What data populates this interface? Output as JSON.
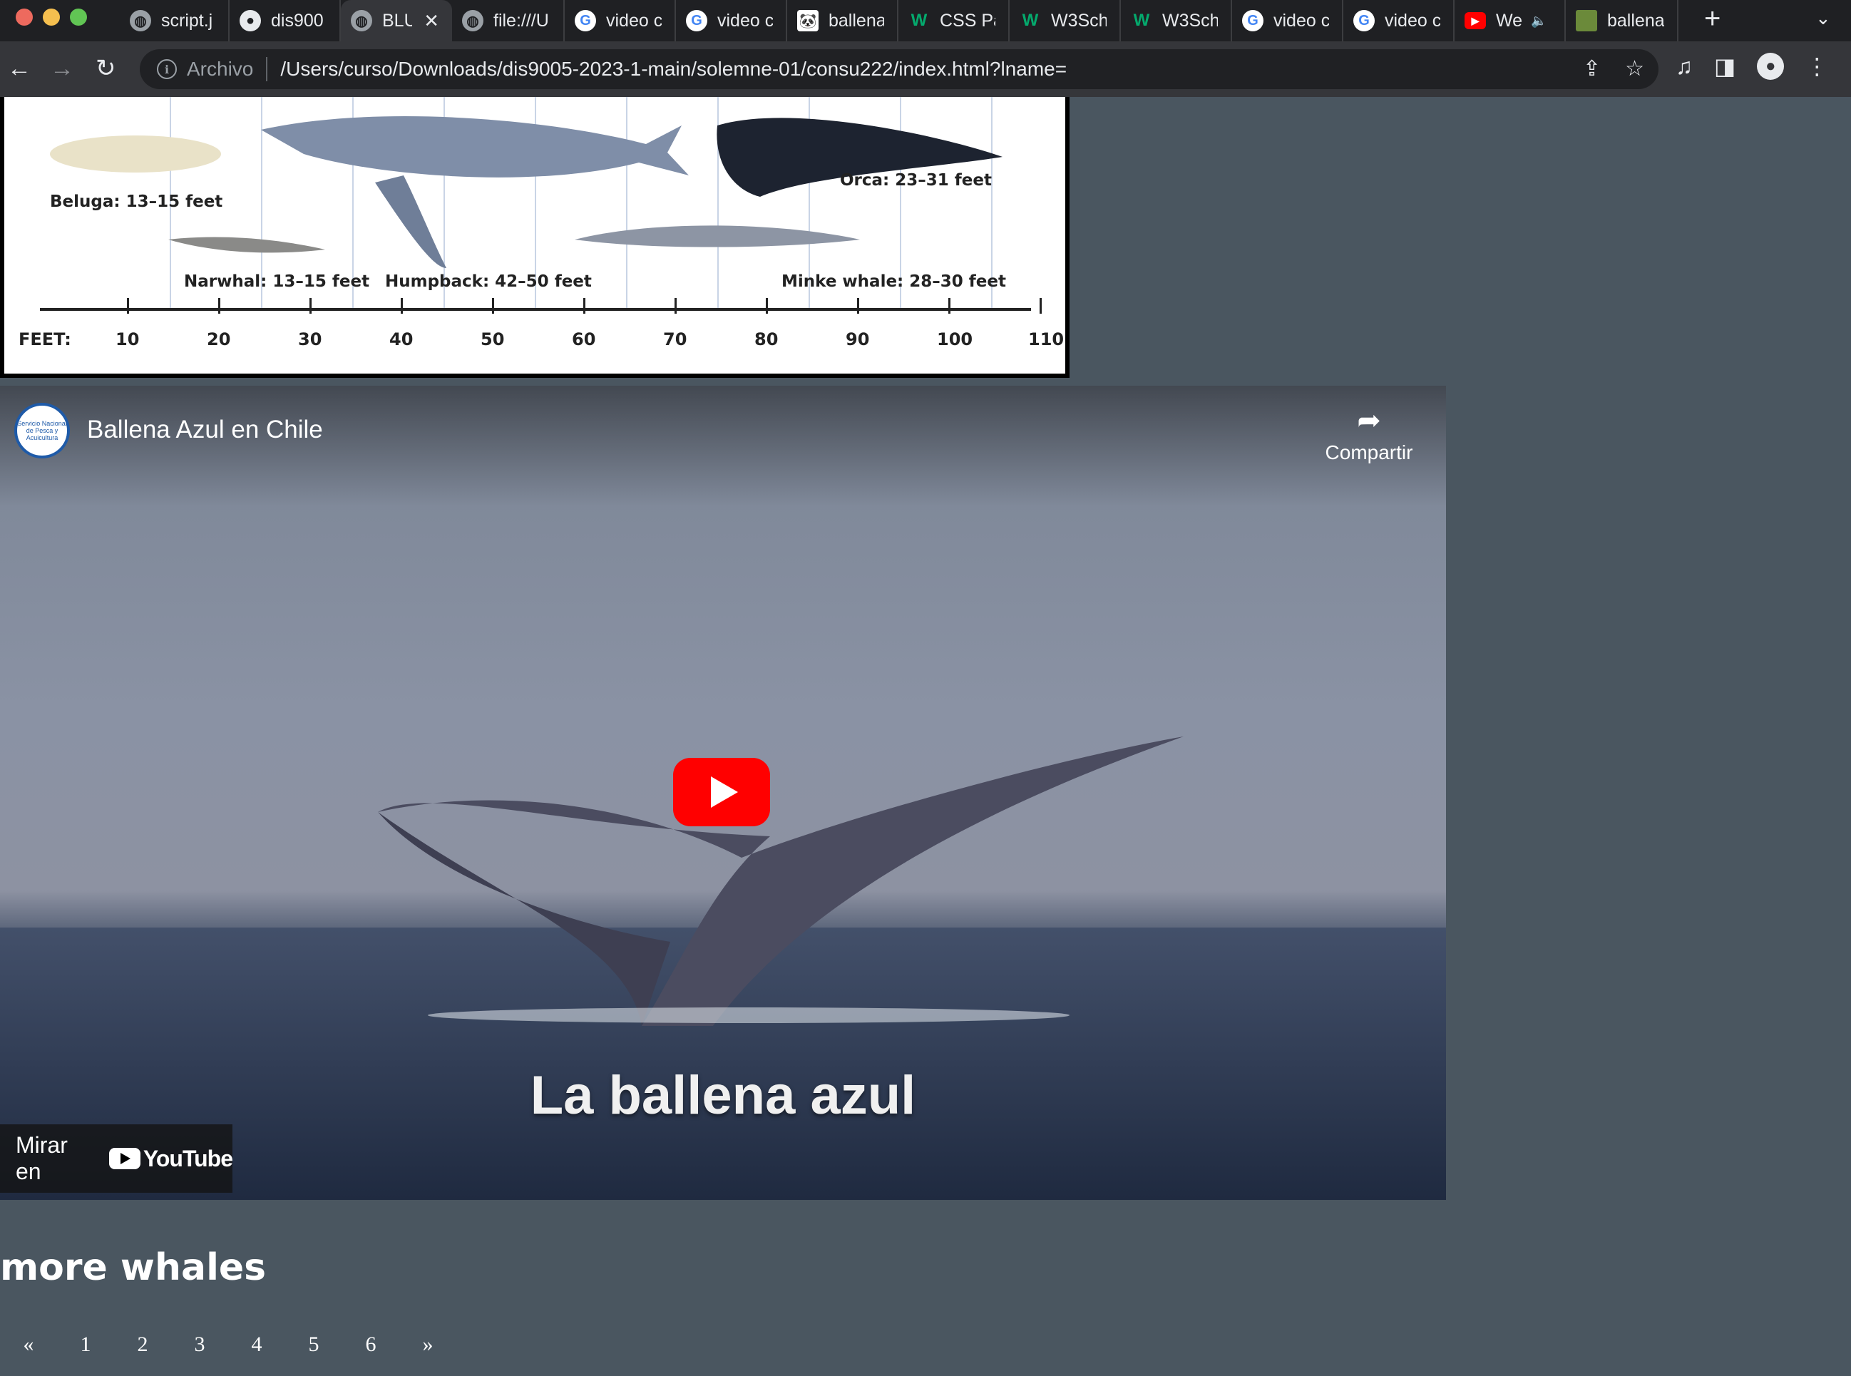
{
  "browser": {
    "tabs": [
      {
        "favicon": "globe-icon",
        "label": "script.j"
      },
      {
        "favicon": "github-icon",
        "label": "dis900"
      },
      {
        "favicon": "globe-icon",
        "label": "BLU",
        "active": true
      },
      {
        "favicon": "globe-icon",
        "label": "file:///U"
      },
      {
        "favicon": "google-icon",
        "label": "video c"
      },
      {
        "favicon": "google-icon",
        "label": "video c"
      },
      {
        "favicon": "wwf-panda-icon",
        "label": "ballena"
      },
      {
        "favicon": "w3schools-icon",
        "label": "CSS Pa"
      },
      {
        "favicon": "w3schools-icon",
        "label": "W3Sch"
      },
      {
        "favicon": "w3schools-icon",
        "label": "W3Sch"
      },
      {
        "favicon": "google-icon",
        "label": "video c"
      },
      {
        "favicon": "google-icon",
        "label": "video c"
      },
      {
        "favicon": "youtube-icon",
        "label": "We",
        "audio": true
      },
      {
        "favicon": "image-icon",
        "label": "ballena"
      }
    ],
    "new_tab_symbol": "+",
    "tab_menu_symbol": "⌄",
    "address": {
      "security_label": "Archivo",
      "url": "/Users/curso/Downloads/dis9005-2023-1-main/solemne-01/consu222/index.html?lname="
    }
  },
  "size_chart": {
    "whales": [
      {
        "label": "Beluga: 13–15 feet"
      },
      {
        "label": "Narwhal: 13–15 feet"
      },
      {
        "label": "Humpback: 42–50 feet"
      },
      {
        "label": "Orca: 23–31 feet"
      },
      {
        "label": "Minke whale: 28–30 feet"
      }
    ],
    "axis_label": "FEET:",
    "ticks": [
      "10",
      "20",
      "30",
      "40",
      "50",
      "60",
      "70",
      "80",
      "90",
      "100",
      "110"
    ]
  },
  "video": {
    "channel_logo_text": "Servicio Nacional de Pesca y Acuicultura",
    "title": "Ballena Azul en Chile",
    "share_label": "Compartir",
    "caption": "La ballena azul",
    "watch_on_label": "Mirar en",
    "youtube_word": "YouTube"
  },
  "section": {
    "title": "more whales"
  },
  "pagination": {
    "prev": "«",
    "pages": [
      "1",
      "2",
      "3",
      "4",
      "5",
      "6"
    ],
    "next": "»"
  }
}
